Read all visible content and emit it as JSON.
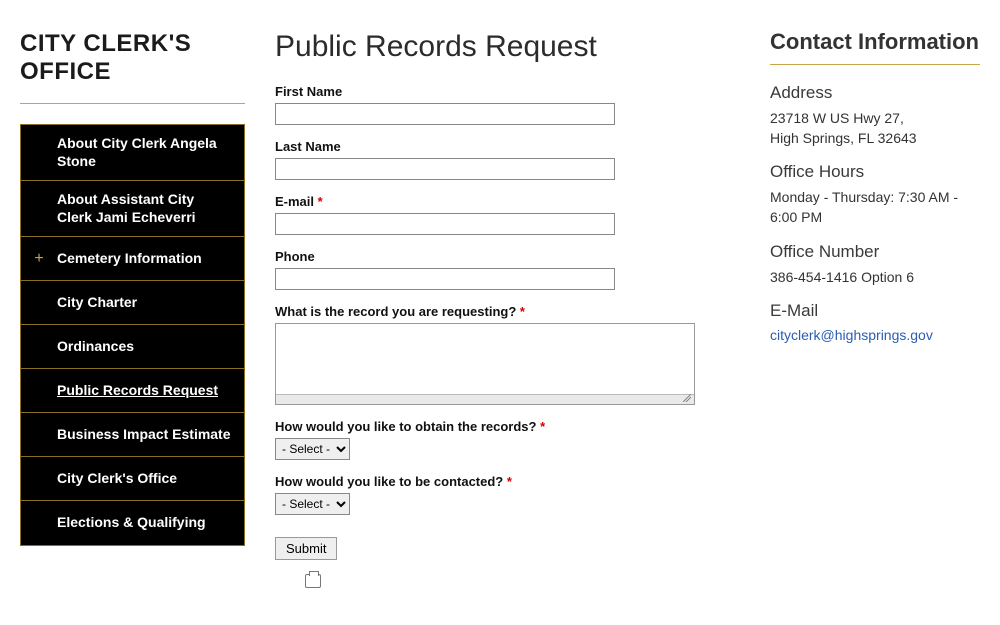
{
  "sidebar": {
    "title": "CITY CLERK'S OFFICE",
    "items": [
      {
        "label": "About City Clerk Angela Stone",
        "expandable": false,
        "active": false
      },
      {
        "label": "About Assistant City Clerk Jami Echeverri",
        "expandable": false,
        "active": false
      },
      {
        "label": "Cemetery Information",
        "expandable": true,
        "active": false
      },
      {
        "label": "City Charter",
        "expandable": false,
        "active": false
      },
      {
        "label": "Ordinances",
        "expandable": false,
        "active": false
      },
      {
        "label": "Public Records Request",
        "expandable": false,
        "active": true
      },
      {
        "label": "Business Impact Estimate",
        "expandable": false,
        "active": false
      },
      {
        "label": "City Clerk's Office",
        "expandable": false,
        "active": false
      },
      {
        "label": "Elections & Qualifying",
        "expandable": false,
        "active": false
      }
    ]
  },
  "main": {
    "title": "Public Records Request",
    "fields": {
      "first_name": {
        "label": "First Name",
        "required": false,
        "value": ""
      },
      "last_name": {
        "label": "Last Name",
        "required": false,
        "value": ""
      },
      "email": {
        "label": "E-mail",
        "required": true,
        "value": ""
      },
      "phone": {
        "label": "Phone",
        "required": false,
        "value": ""
      },
      "record": {
        "label": "What is the record you are requesting?",
        "required": true,
        "value": ""
      },
      "obtain": {
        "label": "How would you like to obtain the records?",
        "required": true,
        "selected": "- Select -"
      },
      "contacted": {
        "label": "How would you like to be contacted?",
        "required": true,
        "selected": "- Select -"
      }
    },
    "submit_label": "Submit"
  },
  "contact": {
    "title": "Contact Information",
    "address_heading": "Address",
    "address_line1": "23718 W US Hwy 27,",
    "address_line2": "High Springs, FL  32643",
    "hours_heading": "Office Hours",
    "hours_text": "Monday - Thursday: 7:30 AM - 6:00 PM",
    "number_heading": "Office Number",
    "number_text": "386-454-1416 Option 6",
    "email_heading": "E-Mail",
    "email_link": "cityclerk@highsprings.gov"
  }
}
